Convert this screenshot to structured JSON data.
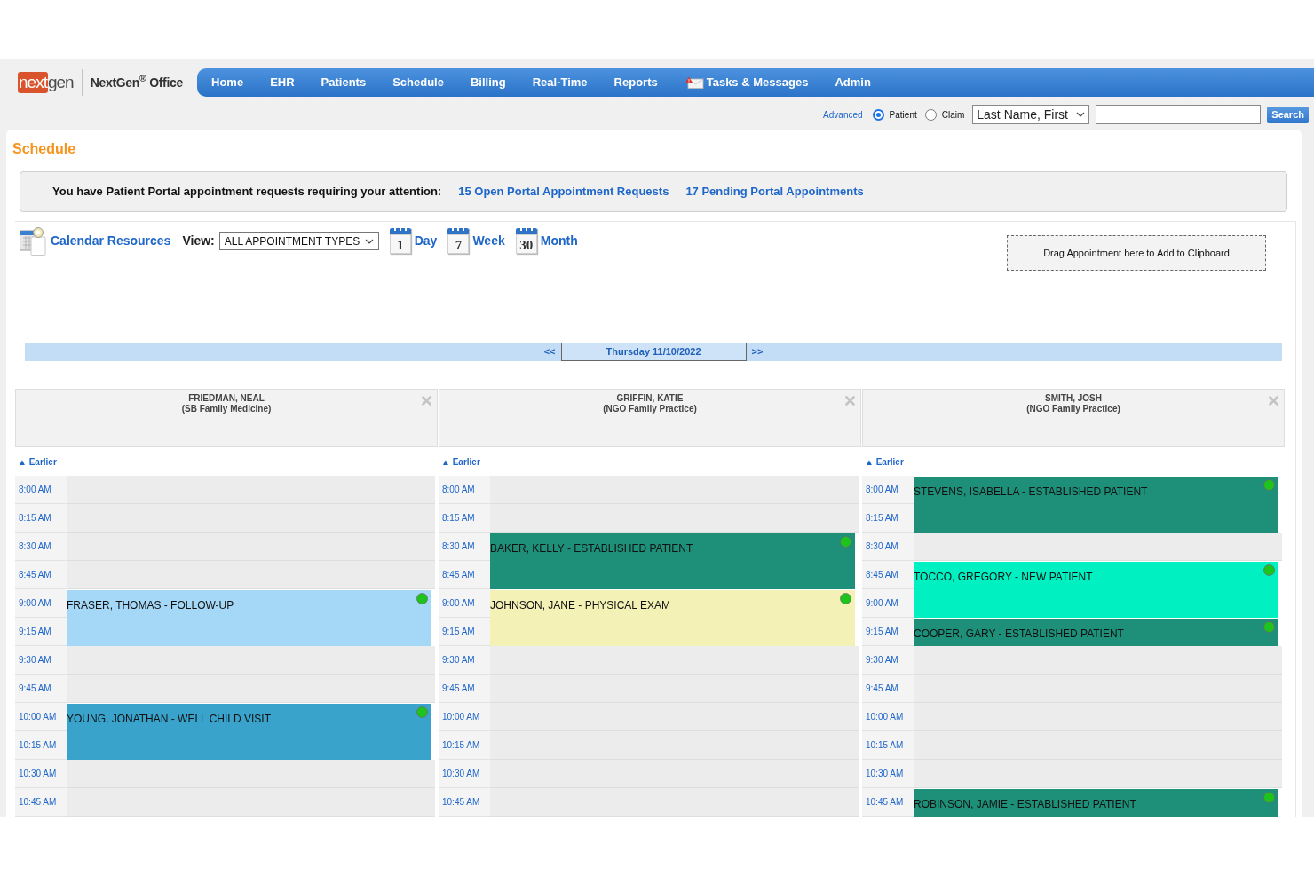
{
  "header": {
    "logo": {
      "part_1": "next",
      "part_2": "gen"
    },
    "product": "NextGen$^{®}$ Office",
    "nav": [
      {
        "label": "Home",
        "kind": "plain"
      },
      {
        "label": "EHR",
        "kind": "plain"
      },
      {
        "label": "Patients",
        "kind": "plain"
      },
      {
        "label": "Schedule",
        "kind": "plain"
      },
      {
        "label": "Billing",
        "kind": "plain"
      },
      {
        "label": "Real-Time",
        "kind": "plain"
      },
      {
        "label": "Reports",
        "kind": "plain"
      },
      {
        "label": "Tasks & Messages",
        "kind": "alert"
      },
      {
        "label": "Admin",
        "kind": "plain"
      }
    ]
  },
  "search": {
    "advanced": "Advanced",
    "scopes": [
      {
        "label": "Patient",
        "selected": true
      },
      {
        "label": "Claim",
        "selected": false
      }
    ],
    "field": "Last Name, First",
    "button": "Search"
  },
  "page_title": "Schedule",
  "portal_notice": {
    "message": "You have Patient Portal appointment requests requiring your attention:",
    "links": [
      "15 Open Portal Appointment Requests",
      "17 Pending Portal Appointments"
    ]
  },
  "toolbar": {
    "resources": "Calendar Resources",
    "view_label": "View:",
    "view_type": "ALL APPOINTMENT TYPES",
    "views": [
      {
        "label": "Day",
        "icon_number": "1"
      },
      {
        "label": "Week",
        "icon_number": "7"
      },
      {
        "label": "Month",
        "icon_number": "30"
      }
    ],
    "clipboard": "Drag Appointment here to Add to Clipboard"
  },
  "date_nav": {
    "previous": "<<",
    "date": "Thursday 11/10/2022",
    "next": ">>"
  },
  "providers": [
    {
      "name": "FRIEDMAN, NEAL",
      "practice": "(SB Family Medicine)",
      "earlier": "▲ Earlier",
      "slots": [
        {
          "time": "8:00 AM",
          "continues": false
        },
        {
          "time": "8:15 AM",
          "continues": false
        },
        {
          "time": "8:30 AM",
          "continues": false
        },
        {
          "time": "8:45 AM",
          "continues": false
        },
        {
          "time": "9:00 AM",
          "appointment": {
            "label": "FRASER, THOMAS - FOLLOW-UP",
            "color": "#a5d8f6"
          }
        },
        {
          "time": "9:15 AM",
          "continues": true
        },
        {
          "time": "9:30 AM",
          "continues": false
        },
        {
          "time": "9:45 AM",
          "continues": false
        },
        {
          "time": "10:00 AM",
          "appointment": {
            "label": "YOUNG, JONATHAN - WELL CHILD VISIT",
            "color": "#3aa3cc"
          }
        },
        {
          "time": "10:15 AM",
          "continues": true
        },
        {
          "time": "10:30 AM",
          "continues": false
        },
        {
          "time": "10:45 AM",
          "continues": false
        }
      ]
    },
    {
      "name": "GRIFFIN, KATIE",
      "practice": "(NGO Family Practice)",
      "earlier": "▲ Earlier",
      "slots": [
        {
          "time": "8:00 AM",
          "continues": false
        },
        {
          "time": "8:15 AM",
          "continues": false
        },
        {
          "time": "8:30 AM",
          "appointment": {
            "label": "BAKER, KELLY - ESTABLISHED PATIENT",
            "color": "#1e8f78"
          }
        },
        {
          "time": "8:45 AM",
          "continues": true
        },
        {
          "time": "9:00 AM",
          "appointment": {
            "label": "JOHNSON, JANE - PHYSICAL EXAM",
            "color": "#f3f1b5"
          }
        },
        {
          "time": "9:15 AM",
          "continues": true
        },
        {
          "time": "9:30 AM",
          "continues": false
        },
        {
          "time": "9:45 AM",
          "continues": false
        },
        {
          "time": "10:00 AM",
          "continues": false
        },
        {
          "time": "10:15 AM",
          "continues": false
        },
        {
          "time": "10:30 AM",
          "continues": false
        },
        {
          "time": "10:45 AM",
          "continues": false
        }
      ]
    },
    {
      "name": "SMITH, JOSH",
      "practice": "(NGO Family Practice)",
      "earlier": "▲ Earlier",
      "slots": [
        {
          "time": "8:00 AM",
          "appointment": {
            "label": "STEVENS, ISABELLA - ESTABLISHED PATIENT",
            "color": "#1e8f78"
          }
        },
        {
          "time": "8:15 AM",
          "continues": true
        },
        {
          "time": "8:30 AM",
          "continues": false
        },
        {
          "time": "8:45 AM",
          "appointment": {
            "label": "TOCCO, GREGORY - NEW PATIENT",
            "color": "#00f0c2"
          }
        },
        {
          "time": "9:00 AM",
          "continues": true
        },
        {
          "time": "9:15 AM",
          "appointment": {
            "label": "COOPER, GARY - ESTABLISHED PATIENT",
            "color": "#1e8f78"
          }
        },
        {
          "time": "9:30 AM",
          "continues": false
        },
        {
          "time": "9:45 AM",
          "continues": false
        },
        {
          "time": "10:00 AM",
          "continues": false
        },
        {
          "time": "10:15 AM",
          "continues": false
        },
        {
          "time": "10:30 AM",
          "continues": false
        },
        {
          "time": "10:45 AM",
          "appointment": {
            "label": "ROBINSON, JAMIE - ESTABLISHED PATIENT",
            "color": "#1e8f78"
          }
        }
      ]
    }
  ]
}
